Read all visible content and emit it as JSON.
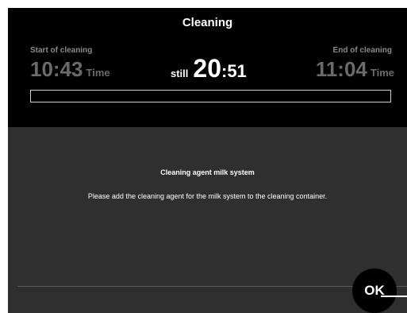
{
  "header": {
    "title": "Cleaning",
    "start": {
      "label": "Start of cleaning",
      "time": "10:43",
      "unit": "Time"
    },
    "remaining": {
      "prefix": "still",
      "minutes": "20",
      "seconds": ":51"
    },
    "end": {
      "label": "End of cleaning",
      "time": "11:04",
      "unit": "Time"
    },
    "progress_fraction": 0.0
  },
  "message": {
    "title": "Cleaning agent milk system",
    "text": "Please add the cleaning agent for the milk system to the cleaning container."
  },
  "actions": {
    "ok_label": "OK"
  },
  "colors": {
    "header_bg": "#000000",
    "body_bg": "#2f2f2f",
    "muted_text": "#6b6b6b",
    "text": "#ffffff"
  }
}
